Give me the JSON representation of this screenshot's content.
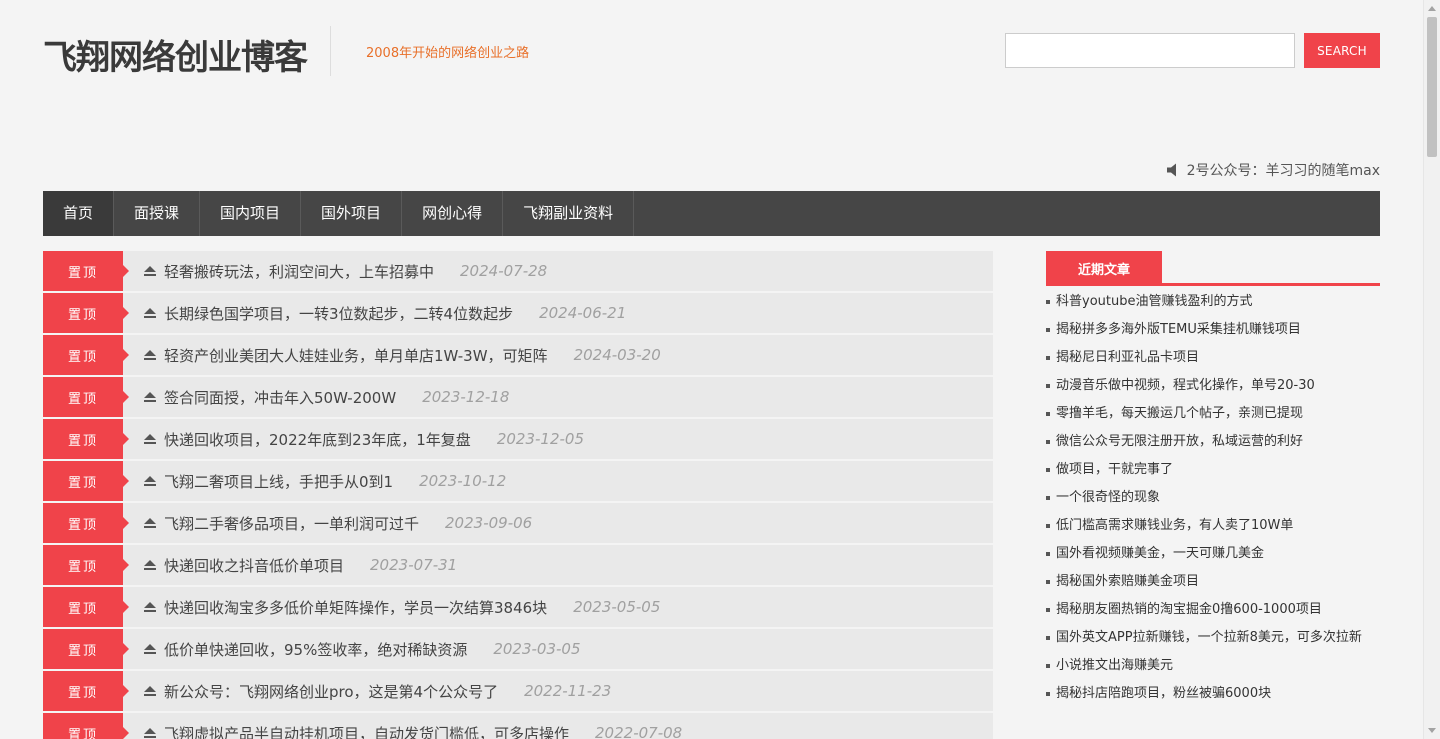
{
  "header": {
    "site_title": "飞翔网络创业博客",
    "tagline": "2008年开始的网络创业之路",
    "search_placeholder": "",
    "search_button": "SEARCH",
    "notice": "2号公众号：羊习习的随笔max"
  },
  "nav": {
    "items": [
      "首页",
      "面授课",
      "国内项目",
      "国外项目",
      "网创心得",
      "飞翔副业资料"
    ]
  },
  "posts": {
    "badge_label": "置顶",
    "items": [
      {
        "title": "轻奢搬砖玩法，利润空间大，上车招募中",
        "date": "2024-07-28"
      },
      {
        "title": "长期绿色国学项目，一转3位数起步，二转4位数起步",
        "date": "2024-06-21"
      },
      {
        "title": "轻资产创业美团大人娃娃业务，单月单店1W-3W，可矩阵",
        "date": "2024-03-20"
      },
      {
        "title": "签合同面授，冲击年入50W-200W",
        "date": "2023-12-18"
      },
      {
        "title": "快递回收项目，2022年底到23年底，1年复盘",
        "date": "2023-12-05"
      },
      {
        "title": "飞翔二奢项目上线，手把手从0到1",
        "date": "2023-10-12"
      },
      {
        "title": "飞翔二手奢侈品项目，一单利润可过千",
        "date": "2023-09-06"
      },
      {
        "title": "快递回收之抖音低价单项目",
        "date": "2023-07-31"
      },
      {
        "title": "快递回收淘宝多多低价单矩阵操作，学员一次结算3846块",
        "date": "2023-05-05"
      },
      {
        "title": "低价单快递回收，95%签收率，绝对稀缺资源",
        "date": "2023-03-05"
      },
      {
        "title": "新公众号：飞翔网络创业pro，这是第4个公众号了",
        "date": "2022-11-23"
      },
      {
        "title": "飞翔虚拟产品半自动挂机项目，自动发货门槛低，可多店操作",
        "date": "2022-07-08"
      }
    ]
  },
  "sidebar": {
    "widget_title": "近期文章",
    "recent": [
      "科普youtube油管赚钱盈利的方式",
      "揭秘拼多多海外版TEMU采集挂机赚钱项目",
      "揭秘尼日利亚礼品卡项目",
      "动漫音乐做中视频，程式化操作，单号20-30",
      "零撸羊毛，每天搬运几个帖子，亲测已提现",
      "微信公众号无限注册开放，私域运营的利好",
      "做项目，干就完事了",
      "一个很奇怪的现象",
      "低门槛高需求赚钱业务，有人卖了10W单",
      "国外看视频赚美金，一天可赚几美金",
      "揭秘国外索赔赚美金项目",
      "揭秘朋友圈热销的淘宝掘金0撸600-1000项目",
      "国外英文APP拉新赚钱，一个拉新8美元，可多次拉新",
      "小说推文出海赚美元",
      "揭秘抖店陪跑项目，粉丝被骗6000块"
    ]
  },
  "colors": {
    "accent": "#f0434a",
    "nav_bg": "#464646",
    "tagline": "#e8702a",
    "background": "#f4f4f4"
  },
  "icons": {
    "notice": "speaker-icon",
    "post": "eject-icon"
  }
}
